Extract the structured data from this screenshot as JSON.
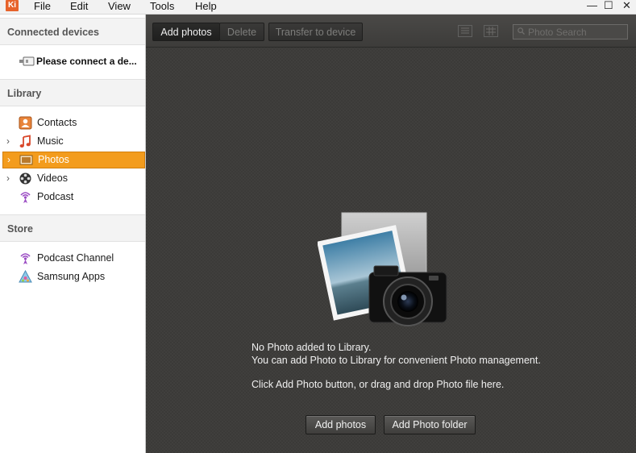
{
  "menu": {
    "app_logo_text": "Ki",
    "items": [
      "File",
      "Edit",
      "View",
      "Tools",
      "Help"
    ],
    "window_controls": {
      "minimize": "—",
      "maximize": "☐",
      "close": "✕"
    }
  },
  "sidebar": {
    "sections": {
      "devices": "Connected devices",
      "library": "Library",
      "store": "Store"
    },
    "device_label": "Please connect a de...",
    "library_items": [
      {
        "label": "Contacts",
        "icon": "contacts-icon",
        "expandable": false,
        "selected": false
      },
      {
        "label": "Music",
        "icon": "music-icon",
        "expandable": true,
        "selected": false
      },
      {
        "label": "Photos",
        "icon": "photos-icon",
        "expandable": true,
        "selected": true
      },
      {
        "label": "Videos",
        "icon": "videos-icon",
        "expandable": true,
        "selected": false
      },
      {
        "label": "Podcast",
        "icon": "podcast-icon",
        "expandable": false,
        "selected": false
      }
    ],
    "store_items": [
      {
        "label": "Podcast Channel",
        "icon": "podcast-icon"
      },
      {
        "label": "Samsung Apps",
        "icon": "samsung-apps-icon"
      }
    ]
  },
  "toolbar": {
    "add_photos": "Add photos",
    "delete": "Delete",
    "transfer": "Transfer to device",
    "search_placeholder": "Photo Search"
  },
  "empty_state": {
    "line1": "No Photo added to Library.",
    "line2": "You can add Photo to Library for convenient Photo management.",
    "line3": "Click Add Photo button, or drag and drop Photo file here.",
    "add_photos_button": "Add photos",
    "add_folder_button": "Add Photo folder"
  },
  "colors": {
    "accent": "#f39c1d",
    "main_bg": "#3b3a38",
    "logo": "#e7632b"
  }
}
